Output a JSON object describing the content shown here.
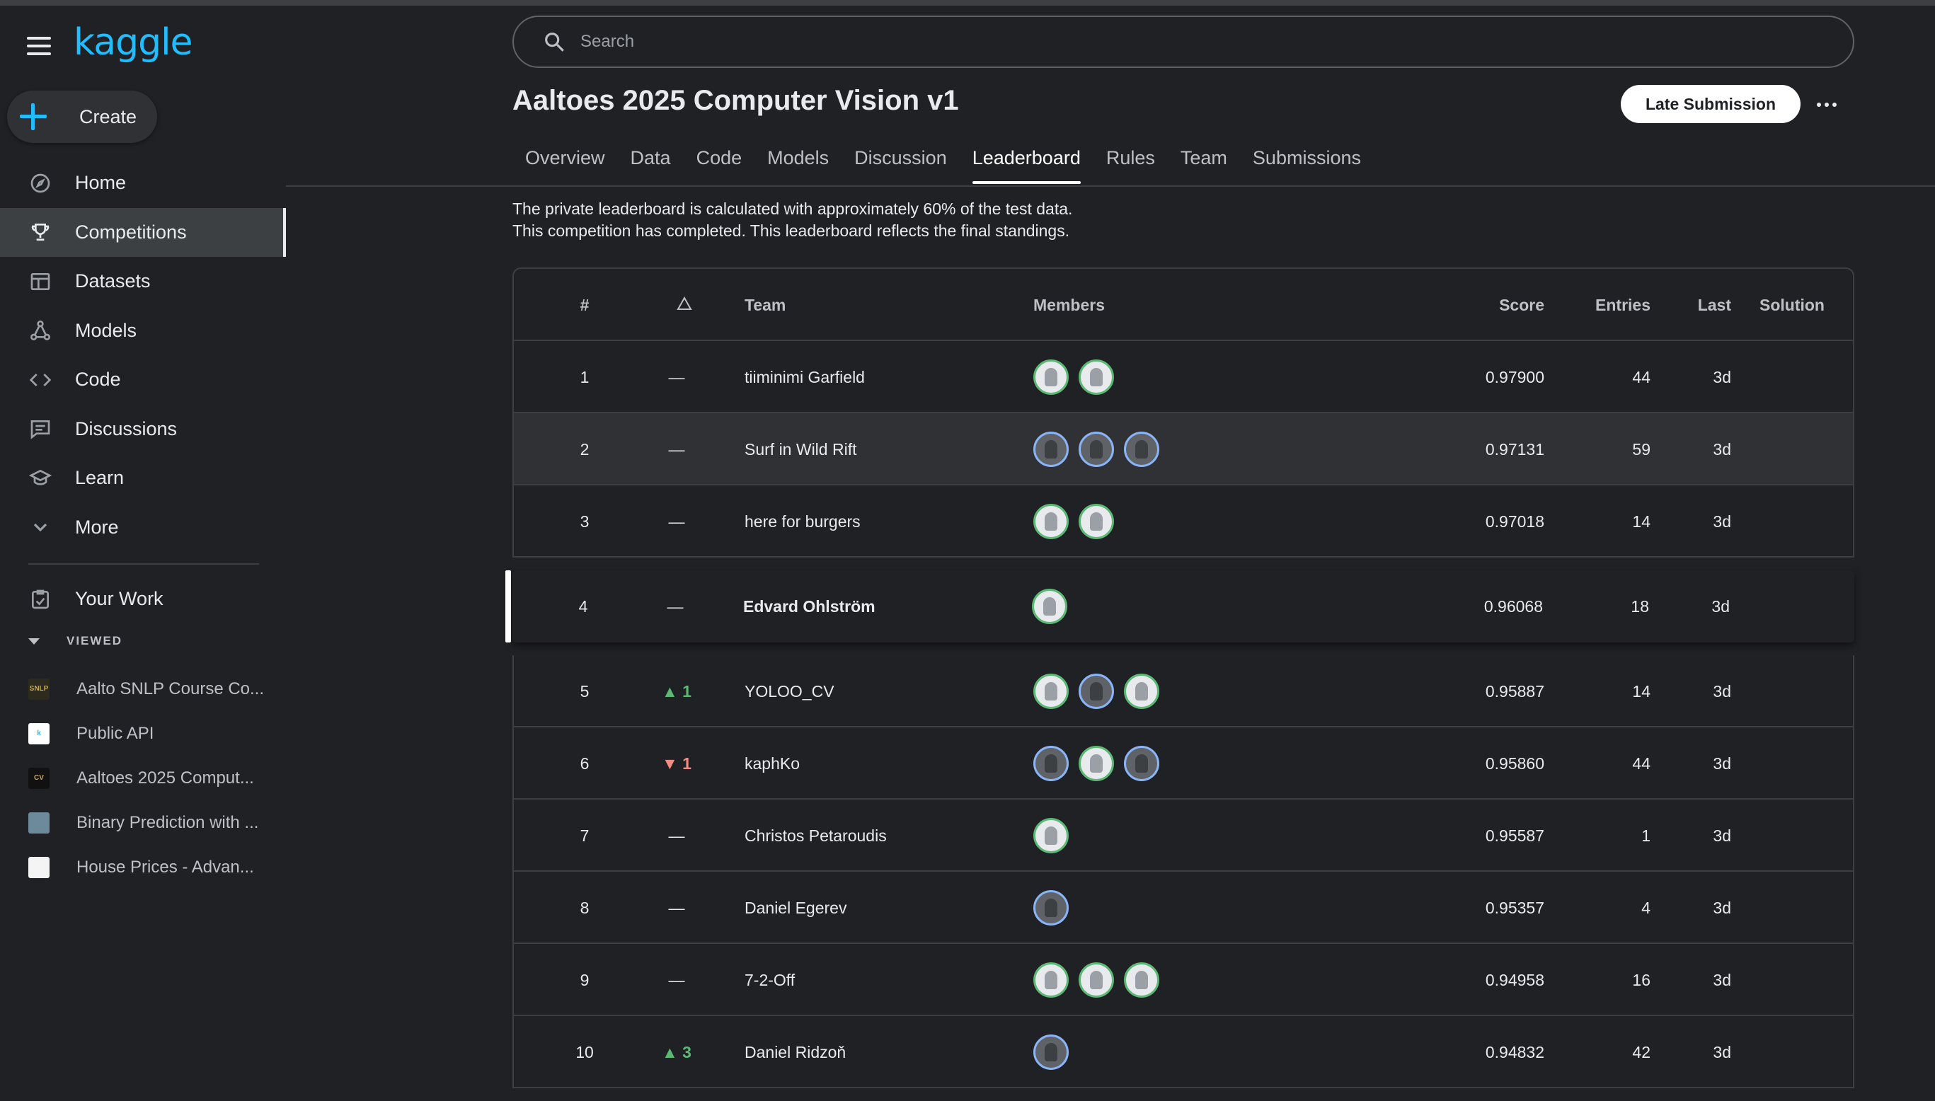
{
  "app": {
    "logo": "kaggle"
  },
  "sidebar": {
    "create_label": "Create",
    "nav": [
      {
        "label": "Home",
        "icon": "compass-icon"
      },
      {
        "label": "Competitions",
        "icon": "trophy-icon",
        "active": true
      },
      {
        "label": "Datasets",
        "icon": "table-icon"
      },
      {
        "label": "Models",
        "icon": "models-icon"
      },
      {
        "label": "Code",
        "icon": "code-icon"
      },
      {
        "label": "Discussions",
        "icon": "comments-icon"
      },
      {
        "label": "Learn",
        "icon": "school-icon"
      },
      {
        "label": "More",
        "icon": "chevron-down-icon"
      }
    ],
    "your_work": "Your Work",
    "viewed_heading": "VIEWED",
    "recent": [
      {
        "label": "Aalto SNLP Course Co...",
        "thumb_text": "SNLP",
        "thumb_color": "#2d2a1e"
      },
      {
        "label": "Public API",
        "thumb_text": "k",
        "thumb_color": "#ffffff"
      },
      {
        "label": "Aaltoes 2025 Comput...",
        "thumb_text": "CV",
        "thumb_color": "#111111"
      },
      {
        "label": "Binary Prediction with ...",
        "thumb_text": "",
        "thumb_color": "#6c8a9a"
      },
      {
        "label": "House Prices - Advan...",
        "thumb_text": "",
        "thumb_color": "#f4f4f4"
      }
    ]
  },
  "search": {
    "placeholder": "Search"
  },
  "competition": {
    "title": "Aaltoes 2025 Computer Vision v1",
    "late_submission_label": "Late Submission",
    "tabs": [
      "Overview",
      "Data",
      "Code",
      "Models",
      "Discussion",
      "Leaderboard",
      "Rules",
      "Team",
      "Submissions"
    ],
    "active_tab": "Leaderboard"
  },
  "notes": {
    "line1": "The private leaderboard is calculated with approximately 60% of the test data.",
    "line2": "This competition has completed. This leaderboard reflects the final standings."
  },
  "leaderboard": {
    "headers": {
      "rank": "#",
      "team": "Team",
      "members": "Members",
      "score": "Score",
      "entries": "Entries",
      "last": "Last",
      "solution": "Solution"
    },
    "rows": [
      {
        "rank": "1",
        "delta": "—",
        "trend": "none",
        "team": "tiiminimi Garfield",
        "members": [
          "default",
          "default"
        ],
        "score": "0.97900",
        "entries": "44",
        "last": "3d"
      },
      {
        "rank": "2",
        "delta": "—",
        "trend": "none",
        "team": "Surf in Wild Rift",
        "members": [
          "photo",
          "photo",
          "photo"
        ],
        "score": "0.97131",
        "entries": "59",
        "last": "3d",
        "hover": true
      },
      {
        "rank": "3",
        "delta": "—",
        "trend": "none",
        "team": "here for burgers",
        "members": [
          "default",
          "default"
        ],
        "score": "0.97018",
        "entries": "14",
        "last": "3d"
      },
      {
        "rank": "4",
        "delta": "—",
        "trend": "none",
        "team": "Edvard Ohlström",
        "members": [
          "default"
        ],
        "score": "0.96068",
        "entries": "18",
        "last": "3d",
        "mine": true
      },
      {
        "rank": "5",
        "delta": "▲ 1",
        "trend": "up",
        "team": "YOLOO_CV",
        "members": [
          "default",
          "photo",
          "default"
        ],
        "score": "0.95887",
        "entries": "14",
        "last": "3d"
      },
      {
        "rank": "6",
        "delta": "▼ 1",
        "trend": "down",
        "team": "kaphKo",
        "members": [
          "photo",
          "default",
          "photo"
        ],
        "score": "0.95860",
        "entries": "44",
        "last": "3d"
      },
      {
        "rank": "7",
        "delta": "—",
        "trend": "none",
        "team": "Christos Petaroudis",
        "members": [
          "default"
        ],
        "score": "0.95587",
        "entries": "1",
        "last": "3d"
      },
      {
        "rank": "8",
        "delta": "—",
        "trend": "none",
        "team": "Daniel Egerev",
        "members": [
          "photo"
        ],
        "score": "0.95357",
        "entries": "4",
        "last": "3d"
      },
      {
        "rank": "9",
        "delta": "—",
        "trend": "none",
        "team": "7-2-Off",
        "members": [
          "default",
          "default",
          "default"
        ],
        "score": "0.94958",
        "entries": "16",
        "last": "3d"
      },
      {
        "rank": "10",
        "delta": "▲ 3",
        "trend": "up",
        "team": "Daniel Ridzoň",
        "members": [
          "photo"
        ],
        "score": "0.94832",
        "entries": "42",
        "last": "3d"
      }
    ]
  }
}
